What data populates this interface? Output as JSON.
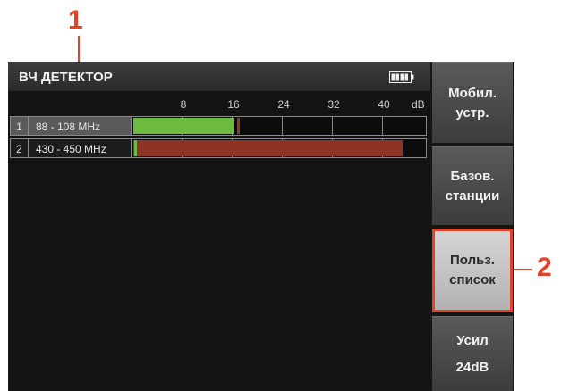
{
  "callouts": {
    "first": "1",
    "second": "2"
  },
  "header": {
    "title": "ВЧ ДЕТЕКТОР",
    "battery_icon": "battery-full-icon"
  },
  "scale": {
    "ticks": [
      "8",
      "16",
      "24",
      "32",
      "40"
    ],
    "unit": "dB",
    "max_db": 48
  },
  "bands": [
    {
      "index": "1",
      "range": "88 - 108   MHz",
      "level_db": 16,
      "peak_db": 16.5,
      "fill_color": "#6dbb3e",
      "peak_color": "#8b3a24",
      "selected": true
    },
    {
      "index": "2",
      "range": "430 - 450 MHz",
      "level_db": 43,
      "peak_db": 0.2,
      "fill_color": "#8e3425",
      "peak_color": "#6dbb3e",
      "selected": false
    }
  ],
  "sidebar": {
    "mobile": {
      "line1": "Мобил.",
      "line2": "устр."
    },
    "base": {
      "line1": "Базов.",
      "line2": "станции"
    },
    "user_list": {
      "line1": "Польз.",
      "line2": "список"
    },
    "gain": {
      "line1": "Усил",
      "line2": "24dB"
    }
  }
}
